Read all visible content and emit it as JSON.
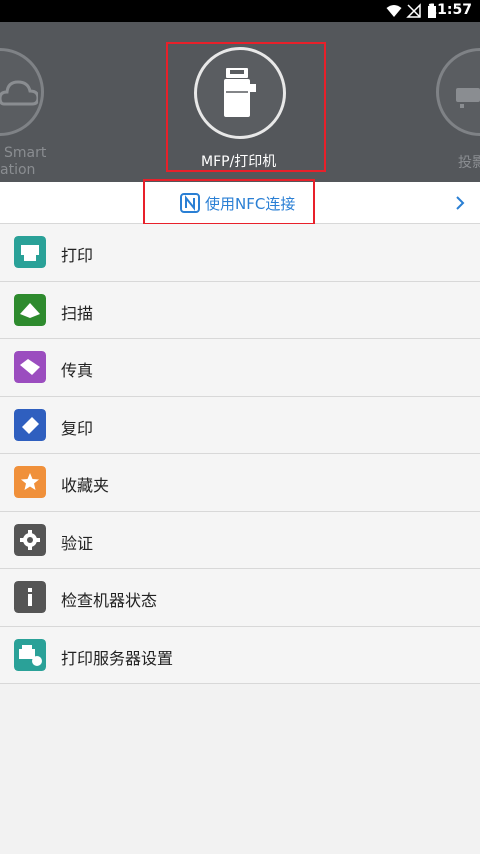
{
  "status_bar": {
    "time": "11:57"
  },
  "carousel": {
    "left_device": {
      "label_line1": "Smart",
      "label_line2": "ation"
    },
    "center_device": {
      "label": "MFP/打印机"
    },
    "right_device": {
      "label": "投影"
    }
  },
  "nfc": {
    "label": "使用NFC连接"
  },
  "menu": {
    "items": [
      {
        "label": "打印",
        "color": "#2aa198"
      },
      {
        "label": "扫描",
        "color": "#2e8b2e"
      },
      {
        "label": "传真",
        "color": "#9b4dbf"
      },
      {
        "label": "复印",
        "color": "#2f5fbf"
      },
      {
        "label": "收藏夹",
        "color": "#f0903a"
      },
      {
        "label": "验证",
        "color": "#555555"
      },
      {
        "label": "检查机器状态",
        "color": "#555555"
      },
      {
        "label": "打印服务器设置",
        "color": "#2aa198"
      }
    ]
  }
}
